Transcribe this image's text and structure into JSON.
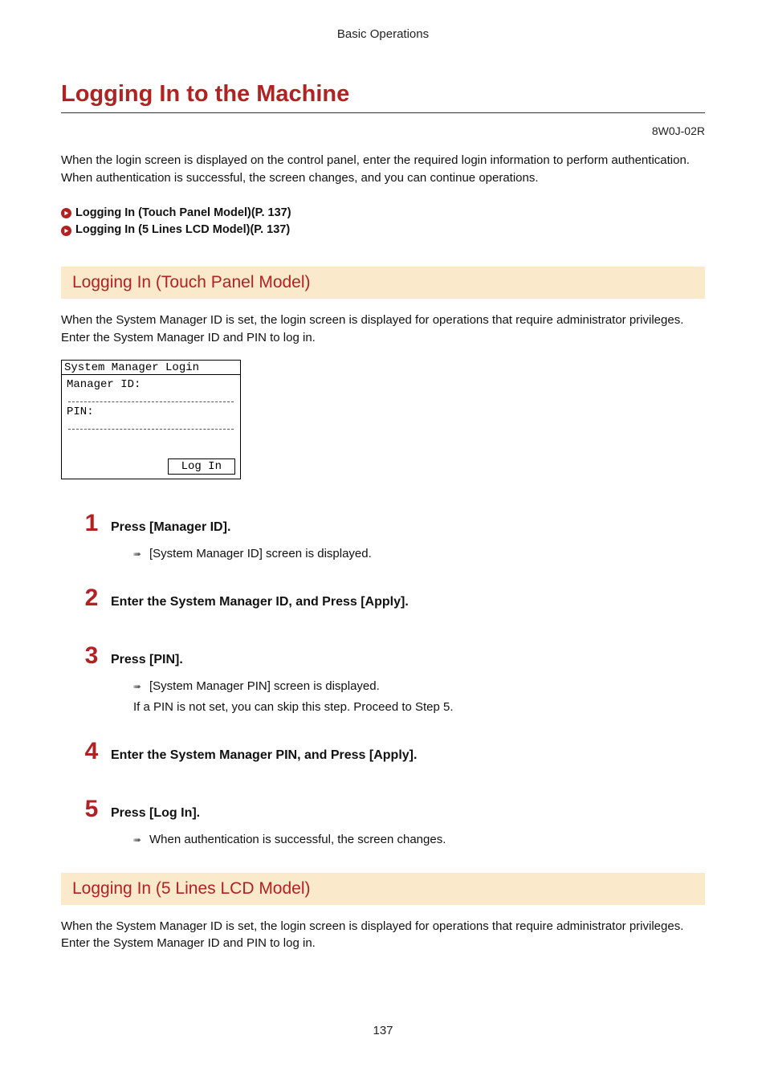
{
  "breadcrumb": "Basic Operations",
  "title": "Logging In to the Machine",
  "doc_code": "8W0J-02R",
  "intro": "When the login screen is displayed on the control panel, enter the required login information to perform authentication. When authentication is successful, the screen changes, and you can continue operations.",
  "toc": [
    "Logging In (Touch Panel Model)(P. 137)",
    "Logging In (5 Lines LCD Model)(P. 137)"
  ],
  "section1": {
    "heading": "Logging In (Touch Panel Model)",
    "intro": "When the System Manager ID is set, the login screen is displayed for operations that require administrator privileges. Enter the System Manager ID and PIN to log in.",
    "screen": {
      "title": "System Manager Login",
      "row1": "Manager ID:",
      "row2": "PIN:",
      "button": "Log In"
    },
    "steps": [
      {
        "num": "1",
        "title": "Press [Manager ID].",
        "body": [
          "[System Manager ID] screen is displayed."
        ],
        "has_arrow": [
          true
        ]
      },
      {
        "num": "2",
        "title": "Enter the System Manager ID, and Press [Apply].",
        "body": [],
        "has_arrow": []
      },
      {
        "num": "3",
        "title": "Press [PIN].",
        "body": [
          "[System Manager PIN] screen is displayed.",
          "If a PIN is not set, you can skip this step. Proceed to Step 5."
        ],
        "has_arrow": [
          true,
          false
        ]
      },
      {
        "num": "4",
        "title": "Enter the System Manager PIN, and Press [Apply].",
        "body": [],
        "has_arrow": []
      },
      {
        "num": "5",
        "title": "Press [Log In].",
        "body": [
          "When authentication is successful, the screen changes."
        ],
        "has_arrow": [
          true
        ]
      }
    ]
  },
  "section2": {
    "heading": "Logging In (5 Lines LCD Model)",
    "intro": "When the System Manager ID is set, the login screen is displayed for operations that require administrator privileges. Enter the System Manager ID and PIN to log in."
  },
  "page_number": "137"
}
